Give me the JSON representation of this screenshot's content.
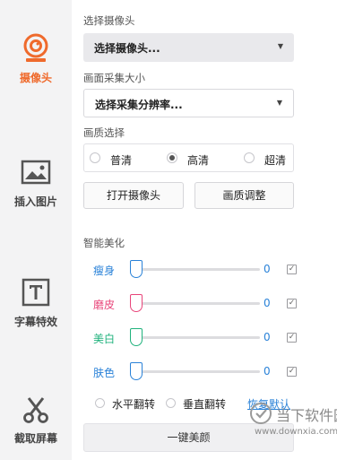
{
  "sidebar": {
    "items": [
      {
        "label": "摄像头",
        "icon": "webcam-icon",
        "active": true
      },
      {
        "label": "插入图片",
        "icon": "image-icon",
        "active": false
      },
      {
        "label": "字幕特效",
        "icon": "text-icon",
        "active": false
      },
      {
        "label": "截取屏幕",
        "icon": "scissors-icon",
        "active": false
      }
    ]
  },
  "camera": {
    "select_title": "选择摄像头",
    "select_value": "选择摄像头...",
    "resolution_title": "画面采集大小",
    "resolution_value": "选择采集分辨率...",
    "quality_title": "画质选择",
    "quality_options": [
      "普清",
      "高清",
      "超清"
    ],
    "quality_selected": "高清",
    "open_button": "打开摄像头",
    "adjust_button": "画质调整"
  },
  "beauty": {
    "title": "智能美化",
    "sliders": [
      {
        "label": "瘦身",
        "value": "0",
        "color": "#2a82d8",
        "checked": true
      },
      {
        "label": "磨皮",
        "value": "0",
        "color": "#e8457a",
        "checked": true
      },
      {
        "label": "美白",
        "value": "0",
        "color": "#1fb27c",
        "checked": true
      },
      {
        "label": "肤色",
        "value": "0",
        "color": "#2a82d8",
        "checked": true
      }
    ],
    "flip_horizontal": "水平翻转",
    "flip_vertical": "垂直翻转",
    "restore_default": "恢复默认",
    "one_click_button": "一键美颜"
  },
  "watermark": {
    "title": "当下软件园",
    "url": "www.downxia.com"
  },
  "colors": {
    "accent": "#ef6a2c",
    "link": "#2a82d8"
  }
}
